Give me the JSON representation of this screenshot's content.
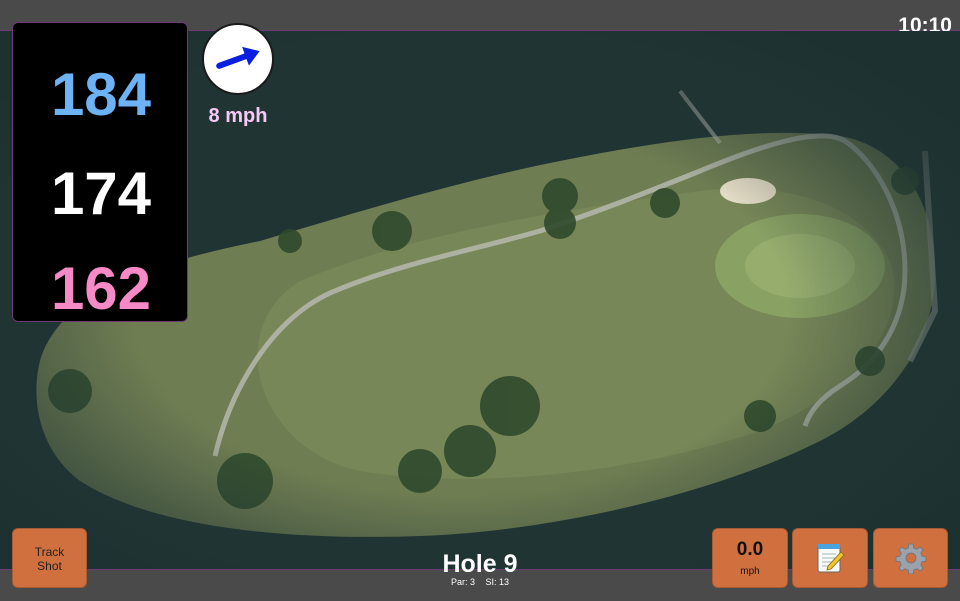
{
  "status": {
    "time": "10:10"
  },
  "distances": {
    "back": "184",
    "middle": "174",
    "front": "162"
  },
  "wind": {
    "speed_label": "8 mph",
    "direction_icon": "wind-arrow-icon"
  },
  "hole": {
    "title": "Hole 9",
    "par_label": "Par: 3",
    "si_label": "SI: 13"
  },
  "buttons": {
    "track_line1": "Track",
    "track_line2": "Shot",
    "speed_value": "0.0",
    "speed_unit": "mph",
    "notes_icon": "scorecard-notepad-icon",
    "settings_icon": "gear-icon"
  },
  "colors": {
    "back": "#6cb2f5",
    "middle": "#ffffff",
    "front": "#f58ac6",
    "wind_label": "#f7c8f4",
    "button": "#d1703f",
    "bar": "#4a4a4a"
  }
}
